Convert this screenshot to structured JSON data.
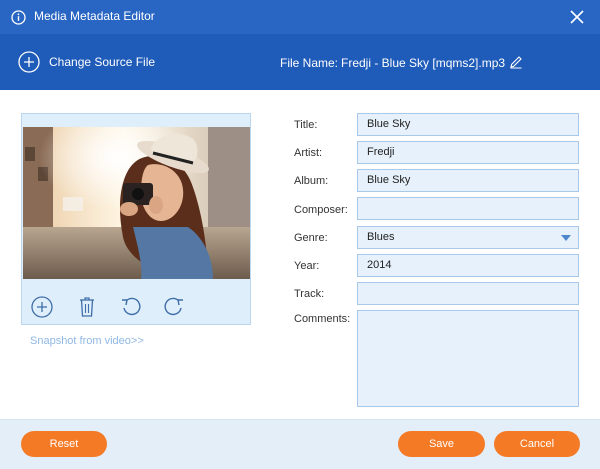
{
  "window": {
    "title": "Media Metadata Editor"
  },
  "toolbar": {
    "change_source": "Change Source File",
    "file_name_label": "File Name:",
    "file_name": "Fredji - Blue Sky [mqms2].mp3"
  },
  "preview": {
    "snapshot_link": "Snapshot from video>>"
  },
  "fields": {
    "title": {
      "label": "Title:",
      "value": "Blue Sky"
    },
    "artist": {
      "label": "Artist:",
      "value": "Fredji"
    },
    "album": {
      "label": "Album:",
      "value": "Blue Sky"
    },
    "composer": {
      "label": "Composer:",
      "value": ""
    },
    "genre": {
      "label": "Genre:",
      "value": "Blues"
    },
    "year": {
      "label": "Year:",
      "value": "2014"
    },
    "track": {
      "label": "Track:",
      "value": ""
    },
    "comments": {
      "label": "Comments:",
      "value": ""
    }
  },
  "buttons": {
    "reset": "Reset",
    "save": "Save",
    "cancel": "Cancel"
  },
  "colors": {
    "titlebar": "#2966c4",
    "toolbar": "#1f5bb9",
    "accent": "#f57a26",
    "field_bg": "#e6f1fb"
  }
}
